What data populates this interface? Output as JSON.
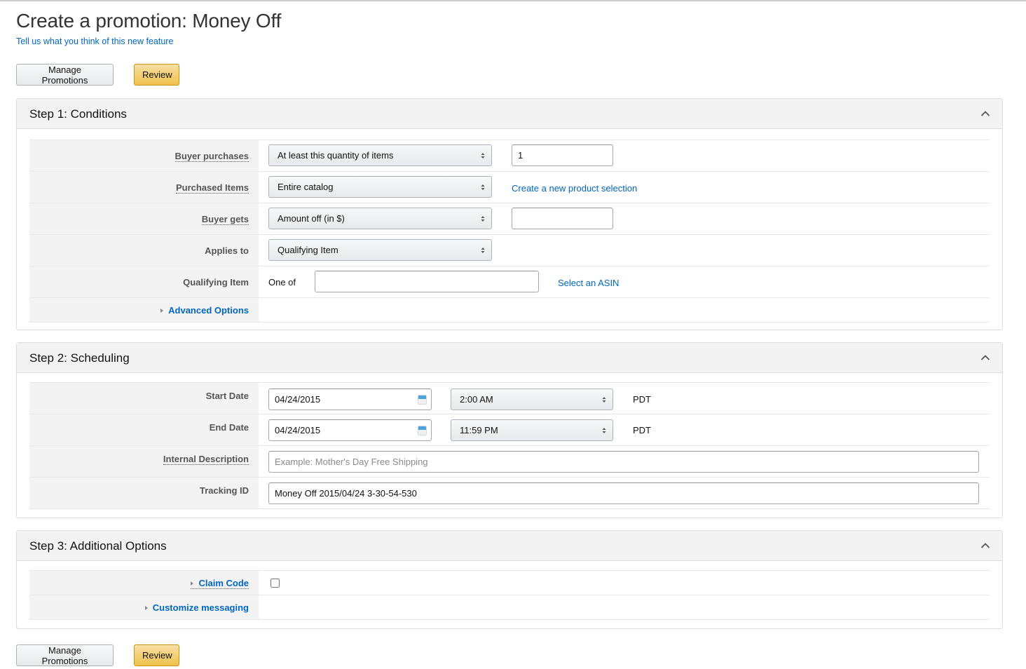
{
  "page": {
    "title": "Create a promotion: Money Off",
    "feedback_link": "Tell us what you think of this new feature"
  },
  "actions": {
    "manage_label": "Manage Promotions",
    "review_label": "Review"
  },
  "colors": {
    "link": "#0066c0",
    "primary_button": "#f0c14b",
    "panel_header": "#f3f3f3"
  },
  "step1": {
    "title": "Step 1: Conditions",
    "collapse_icon": "chevron-up-icon",
    "buyer_purchases": {
      "label": "Buyer purchases",
      "select_value": "At least this quantity of items",
      "quantity_value": "1"
    },
    "purchased_items": {
      "label": "Purchased Items",
      "select_value": "Entire catalog",
      "link": "Create a new product selection"
    },
    "buyer_gets": {
      "label": "Buyer gets",
      "select_value": "Amount off (in $)",
      "amount_value": ""
    },
    "applies_to": {
      "label": "Applies to",
      "select_value": "Qualifying Item"
    },
    "qualifying_item": {
      "label": "Qualifying Item",
      "prefix": "One of",
      "value": "",
      "link": "Select an ASIN"
    },
    "advanced_options": {
      "label": "Advanced Options",
      "icon": "caret-right-icon"
    }
  },
  "step2": {
    "title": "Step 2: Scheduling",
    "collapse_icon": "chevron-up-icon",
    "start_date": {
      "label": "Start Date",
      "date": "04/24/2015",
      "time": "2:00 AM",
      "timezone": "PDT",
      "icon": "calendar-icon"
    },
    "end_date": {
      "label": "End Date",
      "date": "04/24/2015",
      "time": "11:59 PM",
      "timezone": "PDT",
      "icon": "calendar-icon"
    },
    "internal_description": {
      "label": "Internal Description",
      "value": "",
      "placeholder": "Example: Mother's Day Free Shipping"
    },
    "tracking_id": {
      "label": "Tracking ID",
      "value": "Money Off 2015/04/24 3-30-54-530"
    }
  },
  "step3": {
    "title": "Step 3: Additional Options",
    "collapse_icon": "chevron-up-icon",
    "claim_code": {
      "label": "Claim Code",
      "checked": false
    },
    "customize_messaging": {
      "label": "Customize messaging"
    }
  }
}
